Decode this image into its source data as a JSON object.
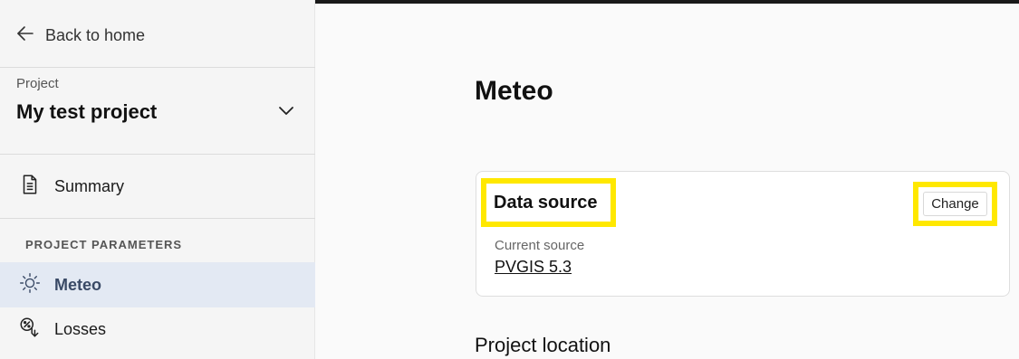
{
  "sidebar": {
    "back_label": "Back to home",
    "project_label": "Project",
    "project_name": "My test project",
    "summary_label": "Summary",
    "section_title": "PROJECT PARAMETERS",
    "meteo_label": "Meteo",
    "losses_label": "Losses"
  },
  "main": {
    "title": "Meteo",
    "data_source": {
      "title": "Data source",
      "change_label": "Change",
      "current_label": "Current source",
      "current_value": "PVGIS 5.3"
    },
    "next_section_title": "Project location"
  },
  "colors": {
    "highlight": "#ffe800",
    "active_nav_bg": "#e3e9f3",
    "topbar": "#1a1a1a"
  },
  "icons": {
    "back": "arrow-left-icon",
    "project_toggle": "chevron-down-icon",
    "summary": "document-icon",
    "meteo": "sun-icon",
    "losses": "losses-icon"
  }
}
